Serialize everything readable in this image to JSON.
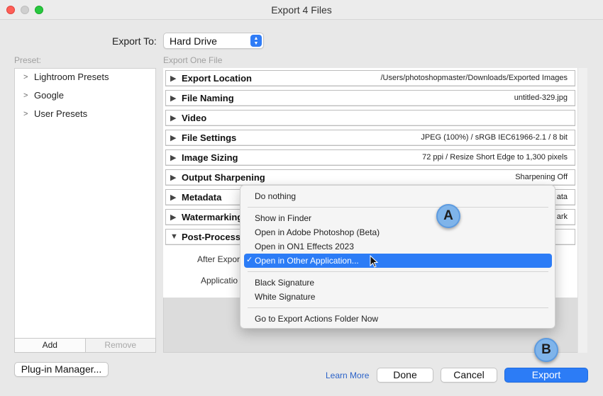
{
  "window": {
    "title": "Export 4 Files"
  },
  "export_to": {
    "label": "Export To:",
    "value": "Hard Drive"
  },
  "preset": {
    "label": "Preset:",
    "items": [
      {
        "label": "Lightroom Presets"
      },
      {
        "label": "Google"
      },
      {
        "label": "User Presets"
      }
    ],
    "add_label": "Add",
    "remove_label": "Remove"
  },
  "main": {
    "label": "Export One File",
    "sections": [
      {
        "title": "Export Location",
        "summary": "/Users/photoshopmaster/Downloads/Exported Images"
      },
      {
        "title": "File Naming",
        "summary": "untitled-329.jpg"
      },
      {
        "title": "Video",
        "summary": ""
      },
      {
        "title": "File Settings",
        "summary": "JPEG (100%) / sRGB IEC61966-2.1 / 8 bit"
      },
      {
        "title": "Image Sizing",
        "summary": "72 ppi / Resize Short Edge to 1,300 pixels"
      },
      {
        "title": "Output Sharpening",
        "summary": "Sharpening Off"
      },
      {
        "title": "Metadata",
        "summary": "ata"
      },
      {
        "title": "Watermarking",
        "summary": "ark"
      },
      {
        "title": "Post-Processing",
        "summary": ""
      }
    ],
    "post_processing": {
      "after_export_label": "After Expor",
      "application_label": "Applicatio"
    }
  },
  "menu": {
    "items": [
      {
        "label": "Do nothing"
      },
      {
        "label": "Show in Finder"
      },
      {
        "label": "Open in Adobe Photoshop (Beta)"
      },
      {
        "label": "Open in ON1 Effects 2023"
      },
      {
        "label": "Open in Other Application..."
      },
      {
        "label": "Black Signature"
      },
      {
        "label": "White Signature"
      },
      {
        "label": "Go to Export Actions Folder Now"
      }
    ],
    "selected_index": 4,
    "check_glyph": "✓"
  },
  "annotations": {
    "a": "A",
    "b": "B"
  },
  "footer": {
    "plugin_manager_label": "Plug-in Manager...",
    "learn_more_label": "Learn More",
    "done_label": "Done",
    "cancel_label": "Cancel",
    "export_label": "Export"
  },
  "colors": {
    "accent": "#2c7cf6",
    "badge": "#7fb4ea",
    "link": "#2b62c8"
  }
}
